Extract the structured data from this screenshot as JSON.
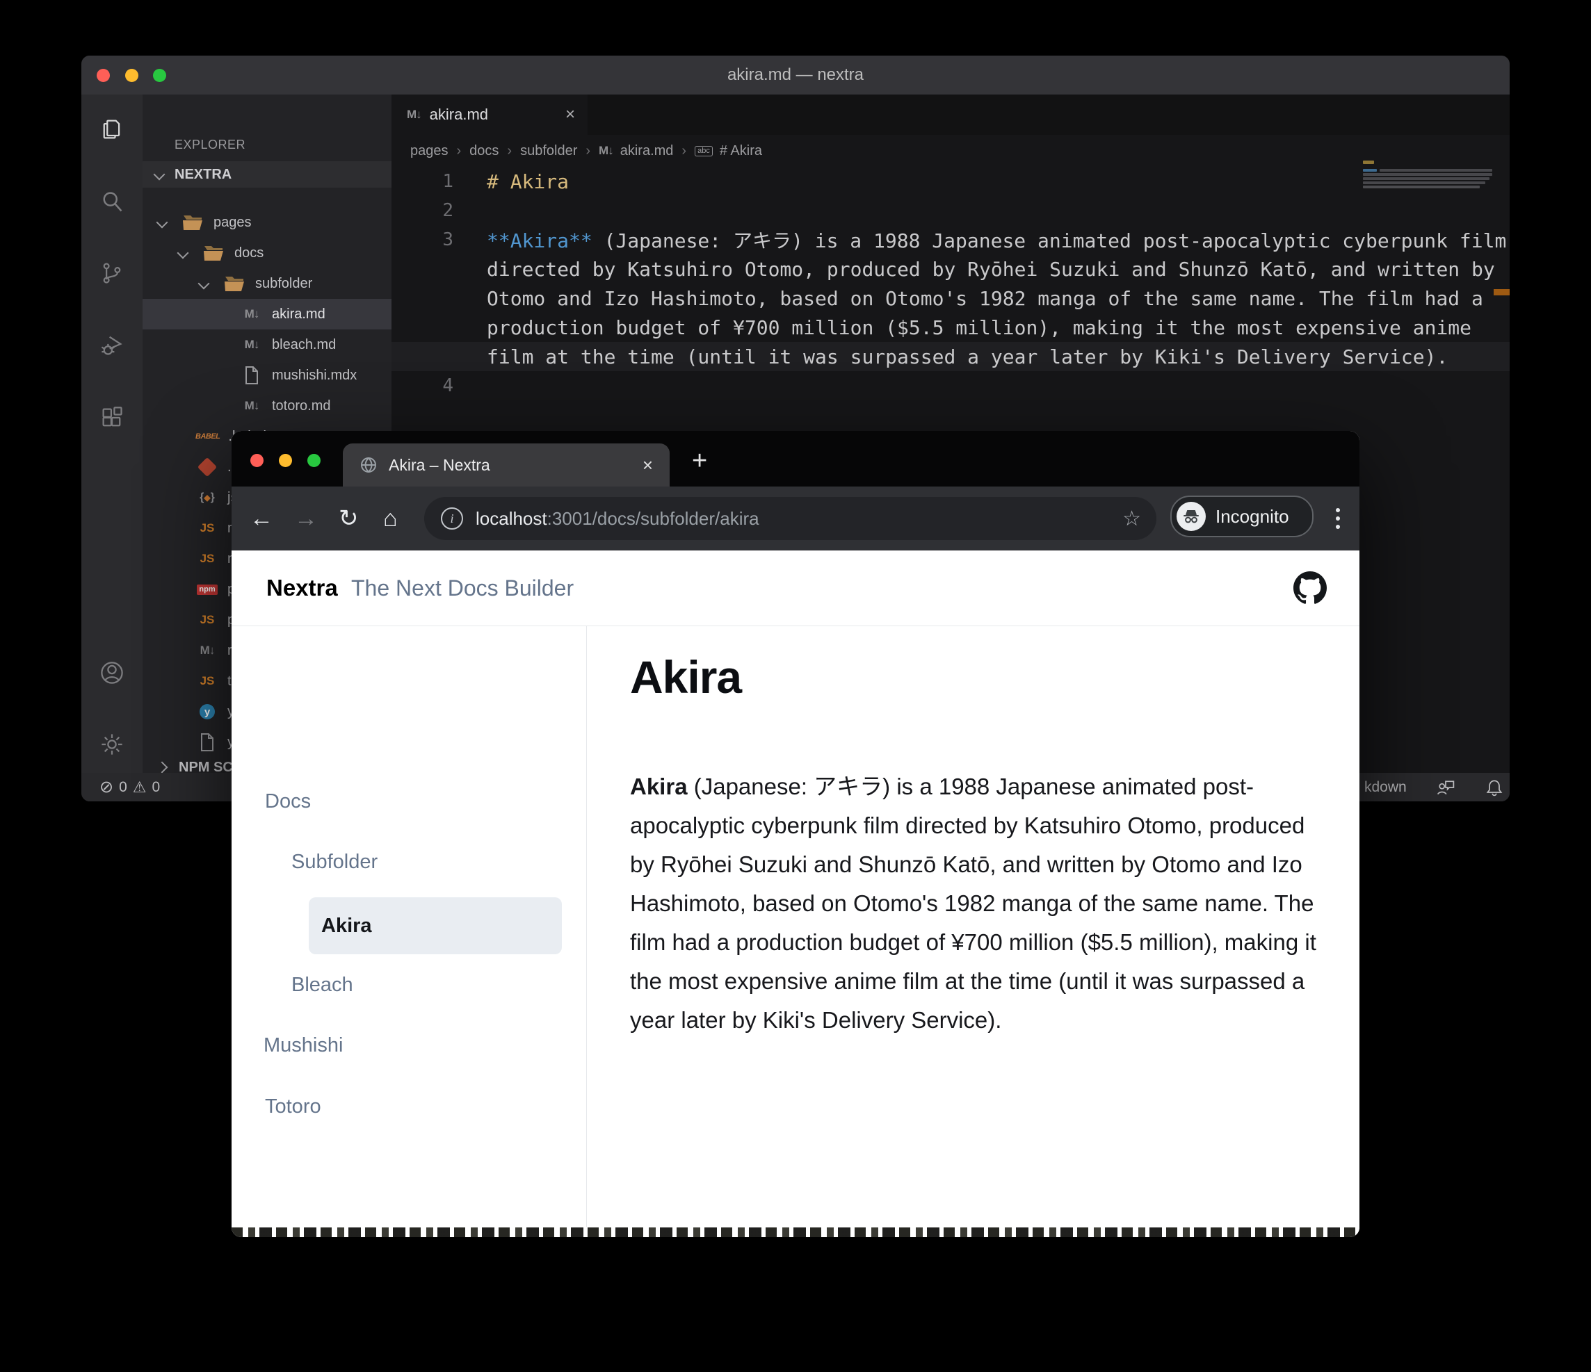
{
  "icons": {
    "close": "×",
    "plus": "+",
    "back": "←",
    "forward": "→",
    "reload": "↻",
    "home": "⌂",
    "star": "☆",
    "info": "i",
    "crumb": "›",
    "error": "⊘",
    "warning": "⚠",
    "md": "M↓",
    "js": "JS",
    "npm": "npm",
    "yarn": "y",
    "babel": "BABEL",
    "json_l": "{",
    "json_diamond": "◆",
    "json_r": "}",
    "abc": "abc"
  },
  "colors": {
    "vs_heading_token": "#d7ba7d",
    "vs_bold_token": "#5196cf",
    "vs_selected_row": "#37373d",
    "scroll_marker": "#9e5a12",
    "traffic_red": "#ff5f57",
    "traffic_yellow": "#febc2e",
    "traffic_green": "#28c840",
    "nextra_link": "#64748b",
    "nextra_active_bg": "#e9edf2"
  },
  "vscode": {
    "title": "akira.md — nextra",
    "explorer_header": "EXPLORER",
    "section": "NEXTRA",
    "npm_section": "NPM SC",
    "tab": {
      "label": "akira.md"
    },
    "breadcrumbs": {
      "b1": "pages",
      "b2": "docs",
      "b3": "subfolder",
      "b4": "akira.md",
      "b5": "# Akira"
    },
    "tree": [
      {
        "label": "pages"
      },
      {
        "label": "docs"
      },
      {
        "label": "subfolder"
      },
      {
        "label": "akira.md"
      },
      {
        "label": "bleach.md"
      },
      {
        "label": "mushishi.mdx"
      },
      {
        "label": "totoro.md"
      },
      {
        "label": ".babelrc"
      },
      {
        "label": ".gitignore"
      },
      {
        "label": "js"
      },
      {
        "label": "n"
      },
      {
        "label": "n"
      },
      {
        "label": "p"
      },
      {
        "label": "p"
      },
      {
        "label": "r"
      },
      {
        "label": "t"
      },
      {
        "label": "y"
      },
      {
        "label": "y"
      }
    ],
    "code": {
      "l1_num": "1",
      "l1_text": "# Akira",
      "l2_num": "2",
      "l3_num": "3",
      "l3_bold": "**Akira**",
      "l3_rest": " (Japanese: アキラ) is a 1988 Japanese animated post-apocalyptic cyberpunk film",
      "l3w2": "directed by Katsuhiro Otomo, produced by Ryōhei Suzuki and Shunzō Katō, and written by",
      "l3w3": "Otomo and Izo Hashimoto, based on Otomo's 1982 manga of the same name. The film had a",
      "l3w4": "production budget of ¥700 million ($5.5 million), making it the most expensive anime",
      "l3w5": "film at the time (until it was surpassed a year later by Kiki's Delivery Service).",
      "l4_num": "4"
    },
    "status": {
      "errors": "0",
      "warnings": "0",
      "language": "kdown"
    }
  },
  "browser": {
    "tab_title": "Akira – Nextra",
    "url_host": "localhost",
    "url_path": ":3001/docs/subfolder/akira",
    "incognito_label": "Incognito",
    "site": {
      "brand": "Nextra",
      "tagline": "The Next Docs Builder",
      "nav": [
        {
          "label": "Docs"
        },
        {
          "label": "Subfolder"
        },
        {
          "label": "Akira"
        },
        {
          "label": "Bleach"
        },
        {
          "label": "Mushishi"
        },
        {
          "label": "Totoro"
        }
      ],
      "heading": "Akira",
      "para_lead": "Akira",
      "para_rest": " (Japanese: アキラ) is a 1988 Japanese animated post-apocalyptic cyberpunk film directed by Katsuhiro Otomo, produced by Ryōhei Suzuki and Shunzō Katō, and written by Otomo and Izo Hashimoto, based on Otomo's 1982 manga of the same name. The film had a production budget of ¥700 million ($5.5 million), making it the most expensive anime film at the time (until it was surpassed a year later by Kiki's Delivery Service)."
    }
  }
}
